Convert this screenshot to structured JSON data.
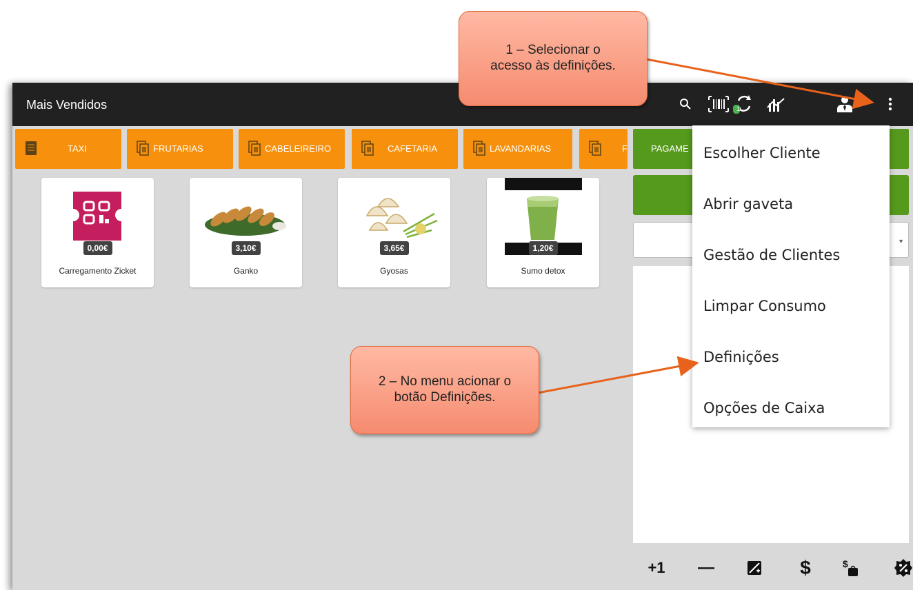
{
  "app": {
    "title": "Mais Vendidos"
  },
  "toolbar_icons": [
    "search-icon",
    "barcode-icon",
    "sync-icon",
    "chart-icon",
    "user-icon",
    "more-vert-icon"
  ],
  "sync_badge": "1",
  "categories": [
    {
      "label": "TAXI",
      "icon": "list-icon"
    },
    {
      "label": "FRUTARIAS",
      "icon": "folder-icon"
    },
    {
      "label": "CABELEIREIRO",
      "icon": "folder-icon"
    },
    {
      "label": "CAFETARIA",
      "icon": "folder-icon"
    },
    {
      "label": "LAVANDARIAS",
      "icon": "folder-icon"
    },
    {
      "label": "F",
      "icon": "folder-icon"
    }
  ],
  "payment_button": "PAGAME",
  "products": [
    {
      "name": "Carregamento Zicket",
      "price": "0,00€"
    },
    {
      "name": "Ganko",
      "price": "3,10€"
    },
    {
      "name": "Gyosas",
      "price": "3,65€"
    },
    {
      "name": "Sumo detox",
      "price": "1,20€"
    }
  ],
  "menu_items": [
    "Escolher Cliente",
    "Abrir gaveta",
    "Gestão de Clientes",
    "Limpar Consumo",
    "Definições",
    "Opções de Caixa"
  ],
  "bottom_actions": {
    "plus_one": "+1",
    "minus": "—",
    "icons": [
      "edit-icon",
      "dollar-icon",
      "dollar-weight-icon",
      "discount-icon"
    ]
  },
  "callouts": {
    "step1": "1 – Selecionar o acesso às definições.",
    "step2": "2 – No menu acionar o botão Definições."
  },
  "colors": {
    "topbar": "#212121",
    "category": "#f7900c",
    "payment": "#559a1c",
    "callout": "#f58b6f",
    "arrow": "#e8621c"
  }
}
